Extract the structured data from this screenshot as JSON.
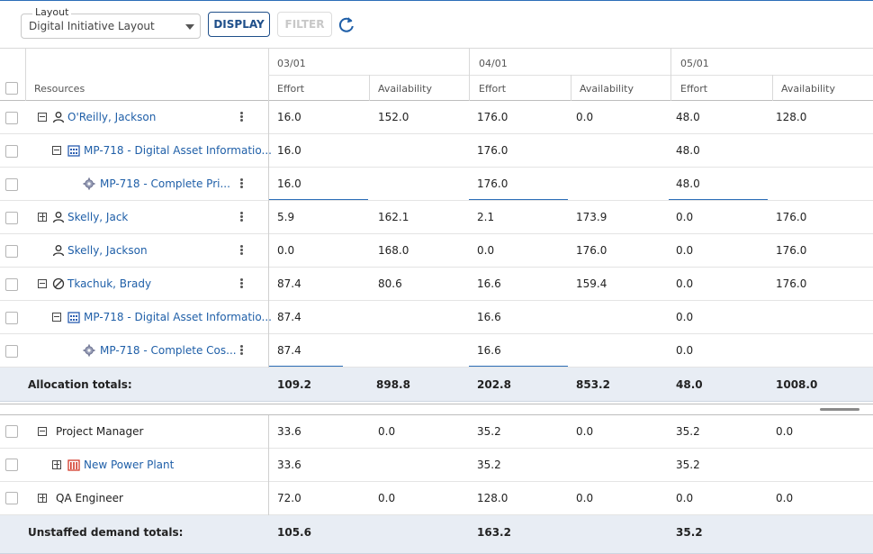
{
  "toolbar": {
    "layout_label": "Layout",
    "layout_value": "Digital Initiative Layout",
    "display_label": "DISPLAY",
    "filter_label": "FILTER",
    "refresh_icon": "refresh-icon"
  },
  "grid": {
    "resources_header": "Resources",
    "periods": [
      "03/01",
      "04/01",
      "05/01"
    ],
    "sub_headers": [
      "Effort",
      "Availability"
    ]
  },
  "rows": [
    {
      "label": "O'Reilly, Jackson",
      "values": [
        "16.0",
        "152.0",
        "176.0",
        "0.0",
        "48.0",
        "128.0"
      ]
    },
    {
      "label": "MP-718 - Digital Asset Informatio...",
      "values": [
        "16.0",
        "",
        "176.0",
        "",
        "48.0",
        ""
      ]
    },
    {
      "label": "MP-718 - Complete Pri...",
      "values": [
        "16.0",
        "",
        "176.0",
        "",
        "48.0",
        ""
      ]
    },
    {
      "label": "Skelly, Jack",
      "values": [
        "5.9",
        "162.1",
        "2.1",
        "173.9",
        "0.0",
        "176.0"
      ]
    },
    {
      "label": "Skelly, Jackson",
      "values": [
        "0.0",
        "168.0",
        "0.0",
        "176.0",
        "0.0",
        "176.0"
      ]
    },
    {
      "label": "Tkachuk, Brady",
      "values": [
        "87.4",
        "80.6",
        "16.6",
        "159.4",
        "0.0",
        "176.0"
      ]
    },
    {
      "label": "MP-718 - Digital Asset Informatio...",
      "values": [
        "87.4",
        "",
        "16.6",
        "",
        "0.0",
        ""
      ]
    },
    {
      "label": "MP-718 - Complete Cos...",
      "values": [
        "87.4",
        "",
        "16.6",
        "",
        "0.0",
        ""
      ]
    }
  ],
  "allocation_totals": {
    "label": "Allocation totals:",
    "values": [
      "109.2",
      "898.8",
      "202.8",
      "853.2",
      "48.0",
      "1008.0"
    ]
  },
  "unstaffed_rows": [
    {
      "label": "Project Manager",
      "values": [
        "33.6",
        "0.0",
        "35.2",
        "0.0",
        "35.2",
        "0.0"
      ]
    },
    {
      "label": "New Power Plant",
      "values": [
        "33.6",
        "",
        "35.2",
        "",
        "35.2",
        ""
      ]
    },
    {
      "label": "QA Engineer",
      "values": [
        "72.0",
        "0.0",
        "128.0",
        "0.0",
        "0.0",
        "0.0"
      ]
    }
  ],
  "unstaffed_totals": {
    "label": "Unstaffed demand totals:",
    "values": [
      "105.6",
      "",
      "163.2",
      "",
      "35.2",
      ""
    ]
  },
  "colors": {
    "accent": "#1f5fa8",
    "totals_bg": "#e8edf4",
    "project_icon": "#2a5db0",
    "plant_icon": "#d23a2a"
  }
}
